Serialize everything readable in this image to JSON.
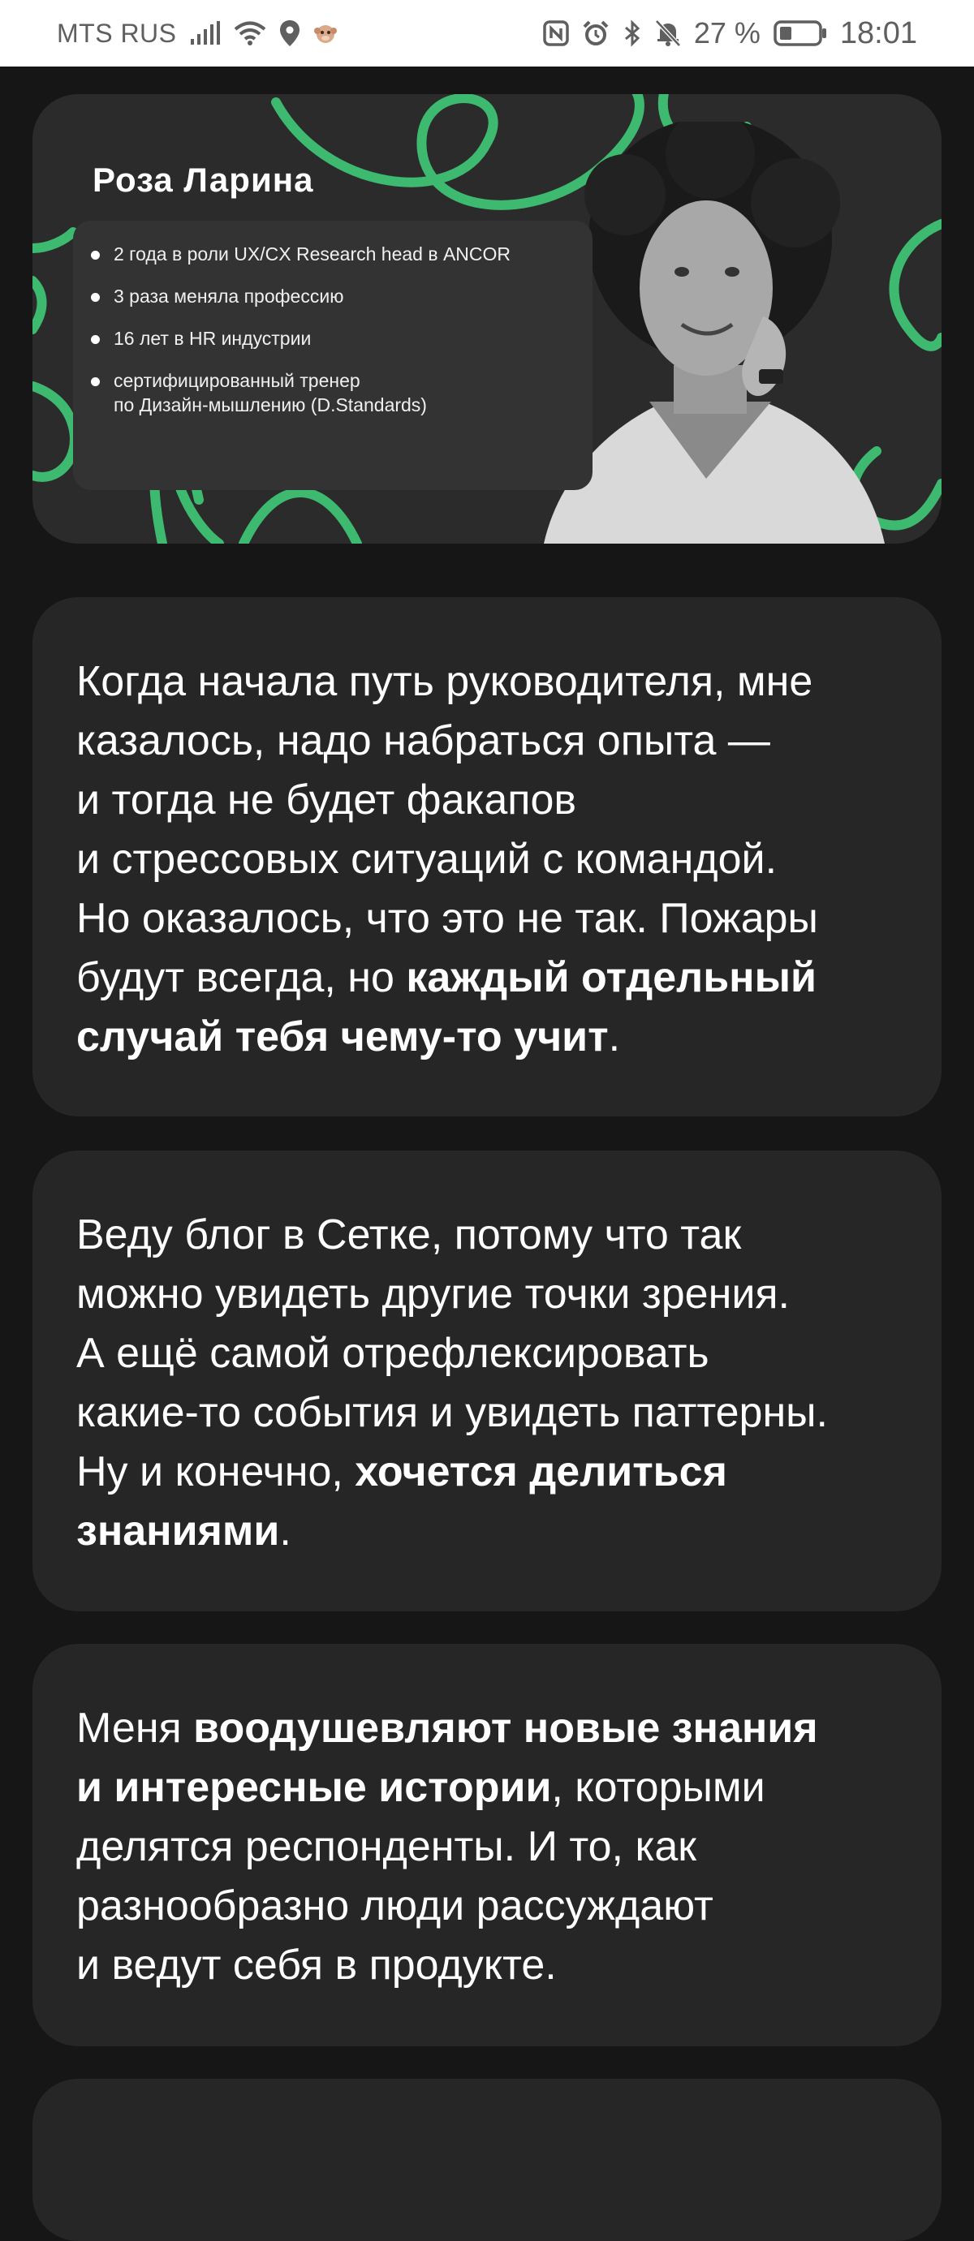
{
  "status_bar": {
    "carrier": "MTS RUS",
    "battery_percent": "27 %",
    "time": "18:01",
    "icons": [
      "signal-icon",
      "wifi-icon",
      "location-icon",
      "monkey-icon",
      "nfc-icon",
      "alarm-icon",
      "bluetooth-icon",
      "mute-icon",
      "battery-icon"
    ]
  },
  "hero": {
    "name": "Роза Ларина",
    "facts": [
      "2 года в роли UX/CX Research head в ANCOR",
      "3 раза меняла профессию",
      "16 лет в HR индустрии"
    ],
    "fact_multi": {
      "line1": "сертифицированный тренер",
      "line2": "по Дизайн-мышлению (D.Standards)"
    },
    "accent_color": "#3dba6f"
  },
  "quotes": {
    "q1": {
      "lines": [
        "Когда начала путь руководителя, мне",
        "казалось, надо набраться опыта —",
        "и тогда не будет факапов",
        "и стрессовых ситуаций с командой.",
        "Но оказалось, что это не так. Пожары"
      ],
      "l6_plain": "будут всегда, но ",
      "l6_bold": "каждый отдельный",
      "l7_bold": "случай тебя чему-то учит",
      "l7_tail": "."
    },
    "q2": {
      "lines": [
        "Веду блог в Сетке, потому что так",
        "можно увидеть другие точки зрения.",
        "А ещё самой отрефлексировать",
        "какие-то события и увидеть паттерны."
      ],
      "l5_plain": "Ну и конечно, ",
      "l5_bold": "хочется делиться",
      "l6_bold": "знаниями",
      "l6_tail": "."
    },
    "q3": {
      "l1_plain": "Меня ",
      "l1_bold": "воодушевляют новые знания",
      "l2_bold": "и интересные истории",
      "l2_tail": ", которыми",
      "lines": [
        "делятся респонденты. И то, как",
        "разнообразно люди рассуждают",
        "и ведут себя в продукте."
      ]
    }
  }
}
